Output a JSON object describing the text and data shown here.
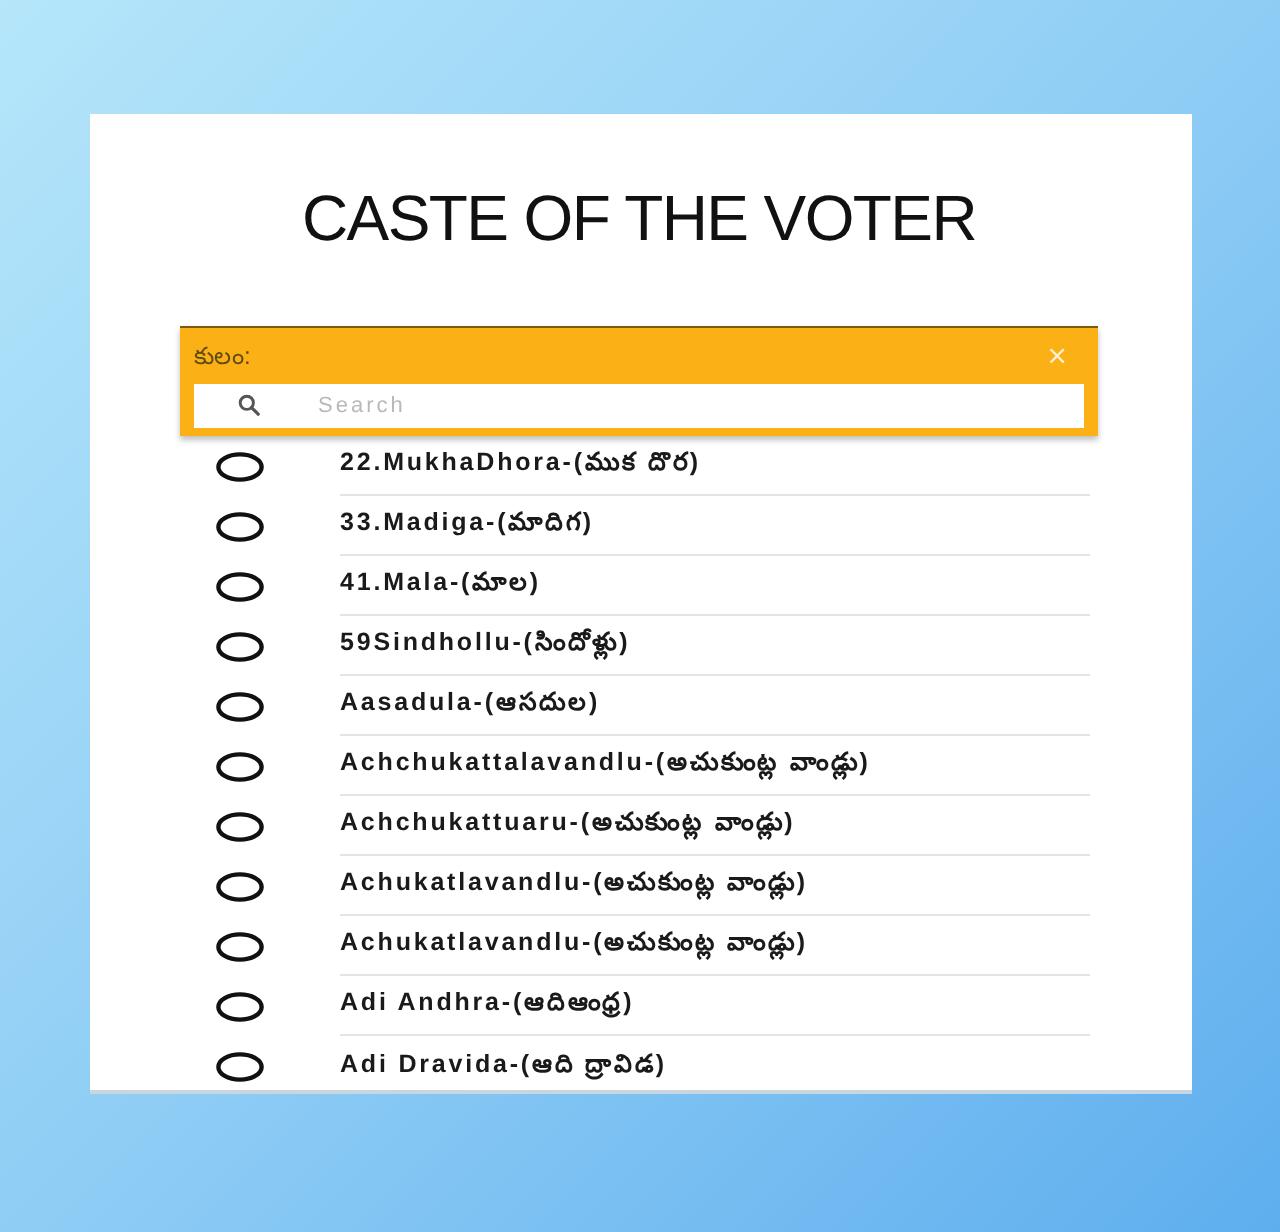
{
  "title": "CASTE OF THE VOTER",
  "dialog": {
    "title": "కులం:",
    "close": "×",
    "search": {
      "placeholder": "Search"
    }
  },
  "options": [
    {
      "label": "22.MukhaDhora-(ముక దొర)",
      "selected": false
    },
    {
      "label": "33.Madiga-(మాదిగ)",
      "selected": false
    },
    {
      "label": "41.Mala-(మాల)",
      "selected": false
    },
    {
      "label": "59Sindhollu-(సిందోళ్లు)",
      "selected": false
    },
    {
      "label": "Aasadula-(ఆసదుల)",
      "selected": false
    },
    {
      "label": "Achchukattalavandlu-(అచుకుంట్ల వాండ్లు)",
      "selected": false
    },
    {
      "label": "Achchukattuaru-(అచుకుంట్ల వాండ్లు)",
      "selected": false
    },
    {
      "label": "Achukatlavandlu-(అచుకుంట్ల వాండ్లు)",
      "selected": false
    },
    {
      "label": "Achukatlavandlu-(అచుకుంట్ల వాండ్లు)",
      "selected": false
    },
    {
      "label": "Adi Andhra-(ఆదిఆంధ్ర)",
      "selected": false
    },
    {
      "label": "Adi Dravida-(ఆది ద్రావిడ)",
      "selected": false
    }
  ]
}
